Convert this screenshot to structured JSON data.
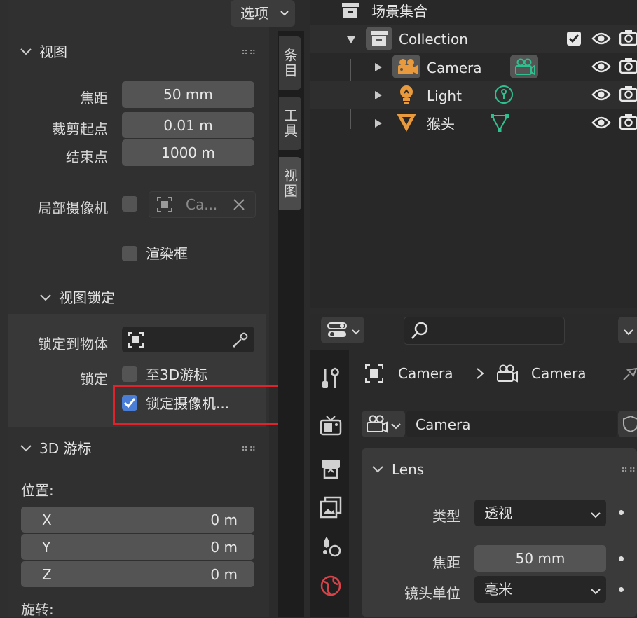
{
  "topbar": {
    "options_label": "选项"
  },
  "view_panel": {
    "title": "视图",
    "focal_length_label": "焦距",
    "focal_length_value": "50 mm",
    "clip_start_label": "裁剪起点",
    "clip_start_value": "0.01 m",
    "clip_end_label": "结束点",
    "clip_end_value": "1000 m",
    "local_camera_label": "局部摄像机",
    "local_camera_value": "Ca...",
    "render_region_label": "渲染框",
    "view_lock_title": "视图锁定",
    "lock_to_object_label": "锁定到物体",
    "lock_label": "锁定",
    "lock_to_cursor_label": "至3D游标",
    "lock_camera_label": "锁定摄像机...",
    "lock_camera_checked": true
  },
  "cursor_panel": {
    "title": "3D 游标",
    "location_label": "位置:",
    "x_label": "X",
    "x_value": "0 m",
    "y_label": "Y",
    "y_value": "0 m",
    "z_label": "Z",
    "z_value": "0 m",
    "rotation_label": "旋转:"
  },
  "side_tabs": [
    "条目",
    "工具",
    "视图"
  ],
  "outliner": {
    "scene_collection": "场景集合",
    "collection": "Collection",
    "items": [
      {
        "name": "Camera"
      },
      {
        "name": "Light"
      },
      {
        "name": "猴头"
      }
    ]
  },
  "properties": {
    "breadcrumb_object": "Camera",
    "breadcrumb_data": "Camera",
    "datablock_name": "Camera",
    "lens_title": "Lens",
    "type_label": "类型",
    "type_value": "透视",
    "focal_label": "焦距",
    "focal_value": "50 mm",
    "lens_unit_label": "镜头单位",
    "lens_unit_value": "毫米"
  },
  "colors": {
    "highlight_box": "#e0222a",
    "checkbox_on": "#4a7dd6",
    "object_orange": "#e89a3c",
    "data_green": "#2fc08f"
  }
}
